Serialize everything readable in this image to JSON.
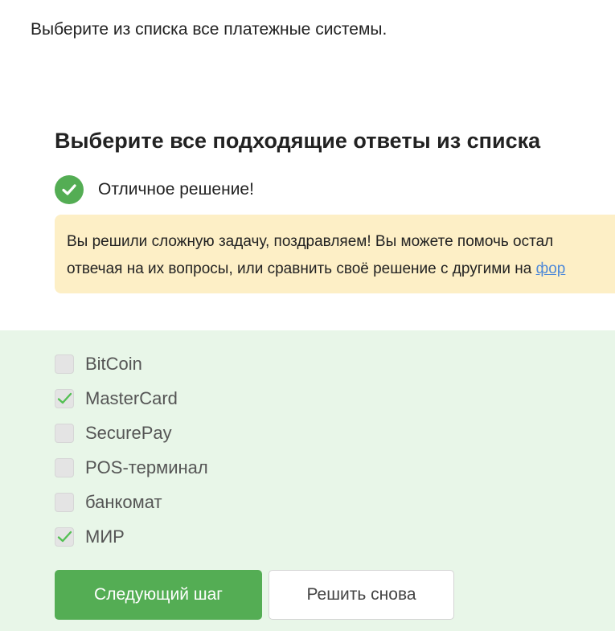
{
  "task": {
    "text": "Выберите из списка все платежные системы."
  },
  "quiz": {
    "heading": "Выберите все подходящие ответы из списка",
    "result_text": "Отличное решение!",
    "hint": {
      "line1": "Вы решили сложную задачу, поздравляем! Вы можете помочь остал",
      "line2": "отвечая на их вопросы, или сравнить своё решение с другими на ",
      "link_text": "фор"
    },
    "options": [
      {
        "label": "BitCoin",
        "checked": false
      },
      {
        "label": "MasterCard",
        "checked": true
      },
      {
        "label": "SecurePay",
        "checked": false
      },
      {
        "label": "POS-терминал",
        "checked": false
      },
      {
        "label": "банкомат",
        "checked": false
      },
      {
        "label": "МИР",
        "checked": true
      }
    ],
    "next_button": "Следующий шаг",
    "retry_button": "Решить снова"
  },
  "colors": {
    "accent_green": "#54ad54",
    "answer_background": "#e8f6e8",
    "hint_background": "#fdefc6",
    "link": "#4e89d8"
  },
  "icons": {
    "result": "check-circle-icon",
    "option_checked": "checkmark-icon"
  }
}
